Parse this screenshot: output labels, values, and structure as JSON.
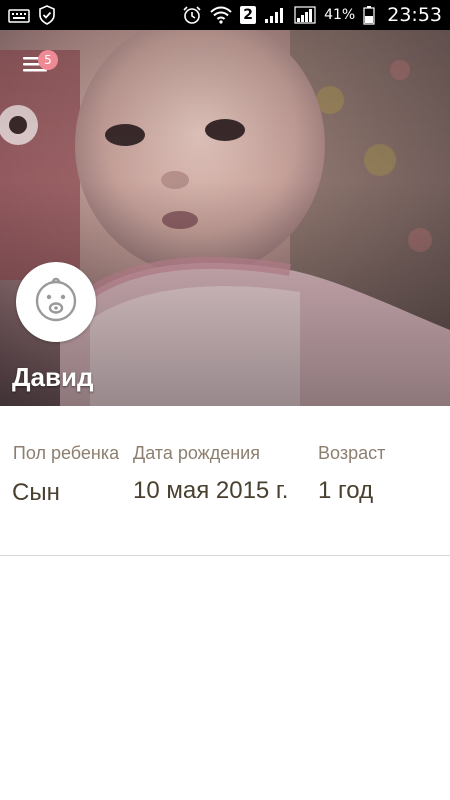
{
  "status_bar": {
    "sim_number": "2",
    "battery_percent": "41%",
    "time": "23:53"
  },
  "header": {
    "notification_count": "5",
    "child_name": "Давид"
  },
  "info": {
    "gender_label": "Пол ребенка",
    "gender_value": "Сын",
    "birth_label": "Дата рождения",
    "birth_value": "10 мая 2015 г.",
    "age_label": "Возраст",
    "age_value": "1 год"
  },
  "colors": {
    "badge": "#ef8a95",
    "label_text": "#8c7f70",
    "value_text": "#4a4030",
    "divider": "#d8d8d8"
  },
  "icons": [
    "keyboard-icon",
    "shield-check-icon",
    "alarm-icon",
    "wifi-icon",
    "signal-icon",
    "battery-icon",
    "menu-icon",
    "baby-face-icon"
  ]
}
